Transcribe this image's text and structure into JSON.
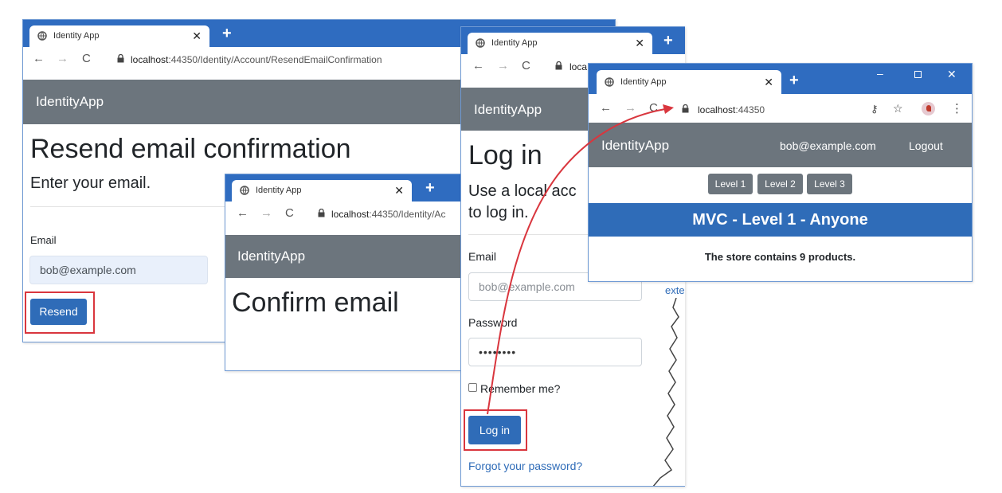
{
  "colors": {
    "tab_strip": "#2f6cc0",
    "navbar": "#6c757d",
    "primary": "#2f6cb8",
    "highlight": "#d9363e",
    "annotation_arrow": "#d9363e"
  },
  "win1": {
    "tab_title": "Identity App",
    "url_host": "localhost",
    "url_rest": ":44350/Identity/Account/ResendEmailConfirmation",
    "brand": "IdentityApp",
    "heading": "Resend email confirmation",
    "subheading": "Enter your email.",
    "email_label": "Email",
    "email_value": "bob@example.com",
    "resend_label": "Resend"
  },
  "win2": {
    "tab_title": "Identity App",
    "url_host": "localhost",
    "url_rest": ":44350/Identity/Ac",
    "brand": "IdentityApp",
    "heading": "Confirm email"
  },
  "win3": {
    "tab_title": "Identity App",
    "url_host": "loca",
    "brand": "IdentityApp",
    "heading": "Log in",
    "sub_line1": "Use a local acc",
    "sub_line2": "to log in.",
    "email_label": "Email",
    "email_value": "bob@example.com",
    "password_label": "Password",
    "password_value": "••••••••",
    "remember_label": "Remember me?",
    "login_label": "Log in",
    "forgot_link": "Forgot your password?",
    "side_link": "exte"
  },
  "win4": {
    "tab_title": "Identity App",
    "url_host": "localhost",
    "url_rest": ":44350",
    "brand": "IdentityApp",
    "user": "bob@example.com",
    "logout": "Logout",
    "levels": [
      "Level 1",
      "Level 2",
      "Level 3"
    ],
    "banner": "MVC - Level 1 - Anyone",
    "message": "The store contains 9 products."
  }
}
